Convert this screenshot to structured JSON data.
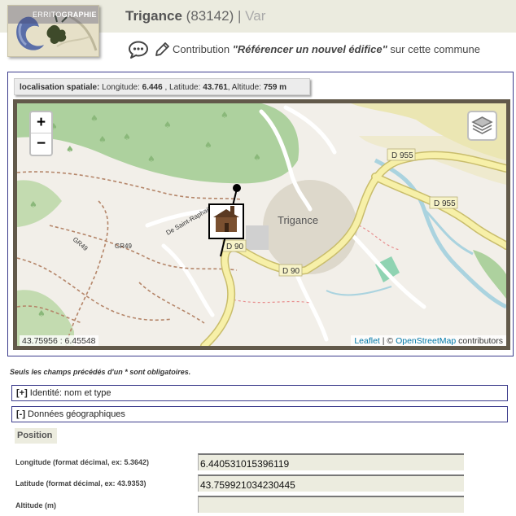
{
  "logo": {
    "text_light": "ERRITO",
    "text_bold": "GRAPHIE"
  },
  "header": {
    "commune": "Trigance",
    "code": "(83142)",
    "separator": "|",
    "department": "Var"
  },
  "contribution": {
    "prefix": "Contribution",
    "action": "\"Référencer un nouvel édifice\"",
    "suffix": "sur cette commune"
  },
  "location": {
    "label": "localisation spatiale:",
    "longitude_label": "Longitude:",
    "longitude": "6.446",
    "latitude_label": "Latitude:",
    "latitude": "43.761",
    "altitude_label": "Altitude:",
    "altitude": "759 m"
  },
  "map": {
    "zoom_in": "+",
    "zoom_out": "−",
    "coordinates": "43.75956 : 6.45548",
    "attribution_leaflet": "Leaflet",
    "attribution_sep": " | © ",
    "attribution_osm": "OpenStreetMap",
    "attribution_tail": " contributors",
    "place_label": "Trigance",
    "road_labels": [
      "D 955",
      "D 955",
      "D 90",
      "D 90",
      "GR49",
      "GR49",
      "De Saint-Raphaël"
    ]
  },
  "form": {
    "required_note": "Seuls les champs précédés d'un * sont obligatoires.",
    "sections": [
      {
        "mark": "[+]",
        "label": " Identité: nom et type"
      },
      {
        "mark": "[-]",
        "label": " Données géographiques"
      }
    ],
    "position_heading": "Position",
    "fields": [
      {
        "label": "Longitude (format décimal, ex: 5.3642)",
        "value": "6.440531015396119"
      },
      {
        "label": "Latitude (format décimal, ex: 43.9353)",
        "value": "43.759921034230445"
      },
      {
        "label": "Altitude (m)",
        "value": ""
      }
    ]
  },
  "colors": {
    "border_blue": "#3c3c8c",
    "field_bg": "#ececdf",
    "map_frame": "#62594a",
    "road_yellow": "#f7f0a8",
    "forest": "#add19e"
  }
}
